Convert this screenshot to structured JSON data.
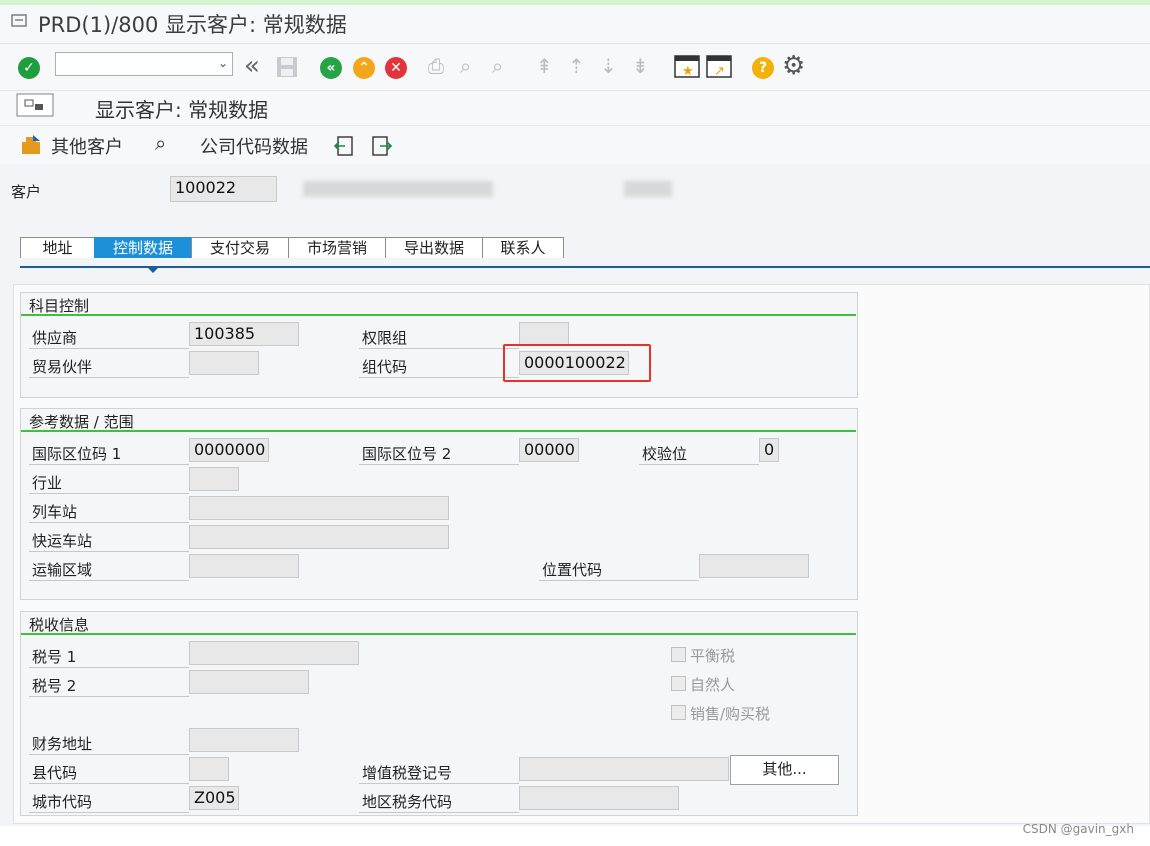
{
  "window": {
    "title": "PRD(1)/800 显示客户: 常规数据"
  },
  "toolbar": {
    "command_value": ""
  },
  "screen": {
    "title": "显示客户: 常规数据"
  },
  "actions": {
    "other_customer": "其他客户",
    "company_code_data": "公司代码数据"
  },
  "header": {
    "customer_label": "客户",
    "customer_value": "100022"
  },
  "tabs": [
    {
      "label": "地址"
    },
    {
      "label": "控制数据"
    },
    {
      "label": "支付交易"
    },
    {
      "label": "市场营销"
    },
    {
      "label": "导出数据"
    },
    {
      "label": "联系人"
    }
  ],
  "section_account": {
    "title": "科目控制",
    "vendor_label": "供应商",
    "vendor_value": "100385",
    "auth_group_label": "权限组",
    "auth_group_value": "",
    "trading_partner_label": "贸易伙伴",
    "trading_partner_value": "",
    "group_key_label": "组代码",
    "group_key_value": "0000100022"
  },
  "section_reference": {
    "title": "参考数据 / 范围",
    "loc1_label": "国际区位码 1",
    "loc1_value": "0000000",
    "loc2_label": "国际区位号 2",
    "loc2_value": "00000",
    "check_label": "校验位",
    "check_value": "0",
    "industry_label": "行业",
    "industry_value": "",
    "train_label": "列车站",
    "train_value": "",
    "express_label": "快运车站",
    "express_value": "",
    "transport_label": "运输区域",
    "transport_value": "",
    "location_label": "位置代码",
    "location_value": ""
  },
  "section_tax": {
    "title": "税收信息",
    "tax1_label": "税号 1",
    "tax1_value": "",
    "tax2_label": "税号 2",
    "tax2_value": "",
    "eq_tax_label": "平衡税",
    "natural_label": "自然人",
    "sales_tax_label": "销售/购买税",
    "fiscal_label": "财务地址",
    "fiscal_value": "",
    "county_label": "县代码",
    "county_value": "",
    "vat_label": "增值税登记号",
    "vat_value": "",
    "other_button": "其他...",
    "city_label": "城市代码",
    "city_value": "Z005",
    "tax_juris_label": "地区税务代码",
    "tax_juris_value": ""
  },
  "watermark": "CSDN @gavin_gxh"
}
